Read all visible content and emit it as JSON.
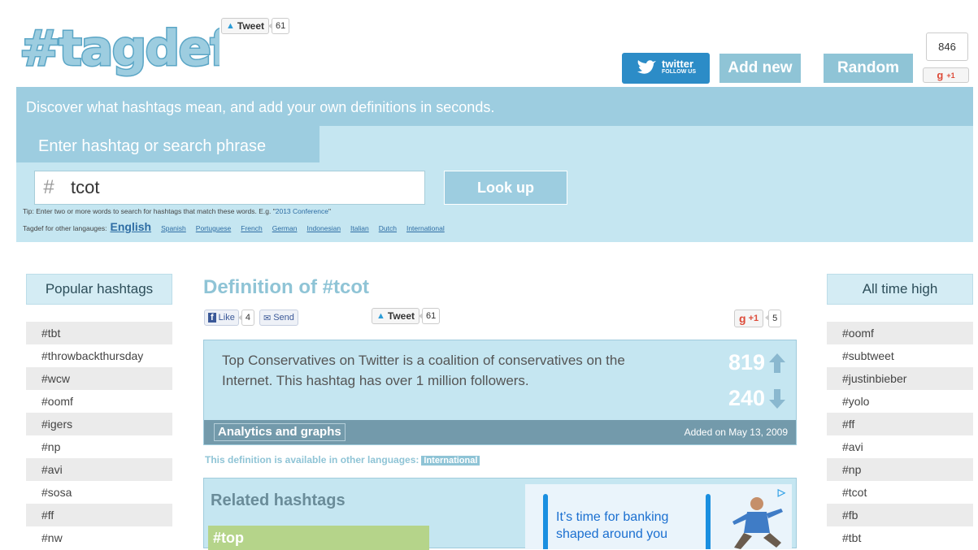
{
  "header": {
    "logo_text": "#tagdef",
    "tweet_label": "Tweet",
    "tweet_count": "61",
    "twitter_follow_big": "twitter",
    "twitter_follow_small": "FOLLOW US",
    "add_new_label": "Add new",
    "random_label": "Random",
    "gplus_count": "846",
    "gplus_label": "+1"
  },
  "hero": {
    "tagline": "Discover what hashtags mean, and add your own definitions in seconds.",
    "search_tab_label": "Enter hashtag or search phrase",
    "search_hash": "#",
    "search_value": "tcot",
    "lookup_label": "Look up",
    "tip_prefix": "Tip: Enter two or more words to search for hashtags that match these words. E.g. \"",
    "tip_example": "2013 Conference",
    "tip_suffix": "\"",
    "langs_label": "Tagdef for other langauges:",
    "langs_current": "English",
    "langs": [
      "Spanish",
      "Portuguese",
      "French",
      "German",
      "Indonesian",
      "Italian",
      "Dutch",
      "International"
    ]
  },
  "popular": {
    "title": "Popular hashtags",
    "items": [
      "#tbt",
      "#throwbackthursday",
      "#wcw",
      "#oomf",
      "#igers",
      "#np",
      "#avi",
      "#sosa",
      "#ff",
      "#nw"
    ]
  },
  "alltime": {
    "title": "All time high",
    "items": [
      "#oomf",
      "#subtweet",
      "#justinbieber",
      "#yolo",
      "#ff",
      "#avi",
      "#np",
      "#tcot",
      "#fb",
      "#tbt"
    ]
  },
  "definition": {
    "title": "Definition of #tcot",
    "fb_like_label": "Like",
    "fb_like_count": "4",
    "fb_send_label": "Send",
    "tweet_label": "Tweet",
    "tweet_count": "61",
    "gplus_label": "+1",
    "gplus_count": "5",
    "text": "Top Conservatives on Twitter is a coalition of conservatives on the Internet. This hashtag has over 1 million followers.",
    "upvotes": "819",
    "downvotes": "240",
    "analytics_label": "Analytics and graphs",
    "added_on": "Added on May 13, 2009",
    "available_label": "This definition is available in other languages:",
    "available_tag": "International"
  },
  "related": {
    "title": "Related hashtags",
    "first_tag": "#top"
  },
  "ad": {
    "text_line1": "It’s time for banking",
    "text_line2": "shaped around you",
    "mark": "▷"
  }
}
